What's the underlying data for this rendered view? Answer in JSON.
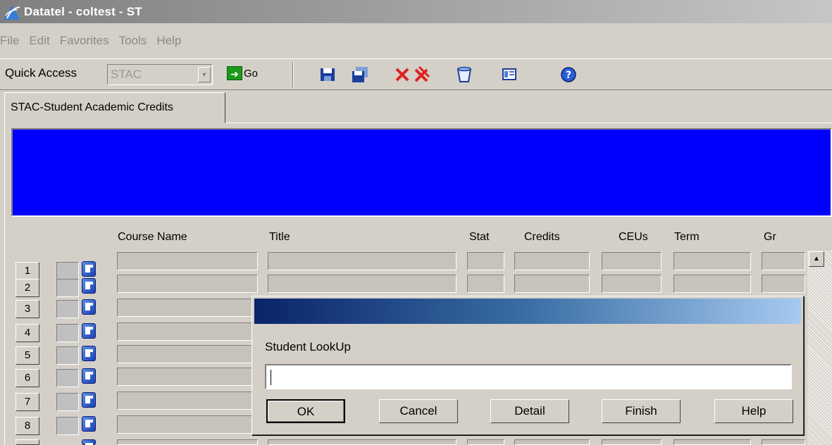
{
  "window": {
    "title": "Datatel - coltest - ST"
  },
  "menu": [
    "File",
    "Edit",
    "Favorites",
    "Tools",
    "Help"
  ],
  "toolbar": {
    "quick_access_label": "Quick Access",
    "quick_access_value": "STAC",
    "go_label": "Go"
  },
  "tab": {
    "label": "STAC-Student Academic Credits"
  },
  "grid": {
    "headers": [
      "Course Name",
      "Title",
      "Stat",
      "Credits",
      "CEUs",
      "Term",
      "Gr"
    ],
    "rows": [
      "1",
      "2",
      "3",
      "4",
      "5",
      "6",
      "7",
      "8"
    ]
  },
  "dialog": {
    "label": "Student LookUp",
    "input_value": "",
    "buttons": [
      "OK",
      "Cancel",
      "Detail",
      "Finish",
      "Help"
    ]
  },
  "colors": {
    "blue_area": "#0000ff",
    "dialog_title_start": "#0a246a",
    "dialog_title_end": "#a6caf0"
  }
}
